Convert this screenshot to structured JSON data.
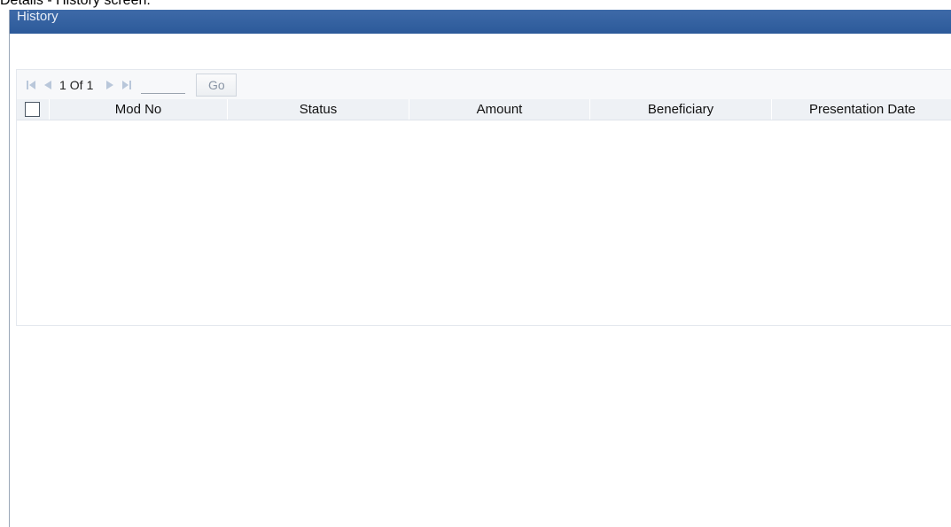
{
  "caption": "Details - History screen.",
  "window": {
    "title": "History"
  },
  "pager": {
    "current_page": "1",
    "of_label": "Of",
    "total_pages": "1",
    "page_input_value": "",
    "go_label": "Go"
  },
  "table": {
    "columns": [
      "Mod No",
      "Status",
      "Amount",
      "Beneficiary",
      "Presentation Date"
    ],
    "rows": []
  },
  "icons": {
    "first": "first-page-icon",
    "prev": "previous-page-icon",
    "next": "next-page-icon",
    "last": "last-page-icon"
  },
  "colors": {
    "title_bar": "#2f5d9c",
    "pager_icons": "#b9c7da",
    "header_bg": "#eef1f5"
  }
}
